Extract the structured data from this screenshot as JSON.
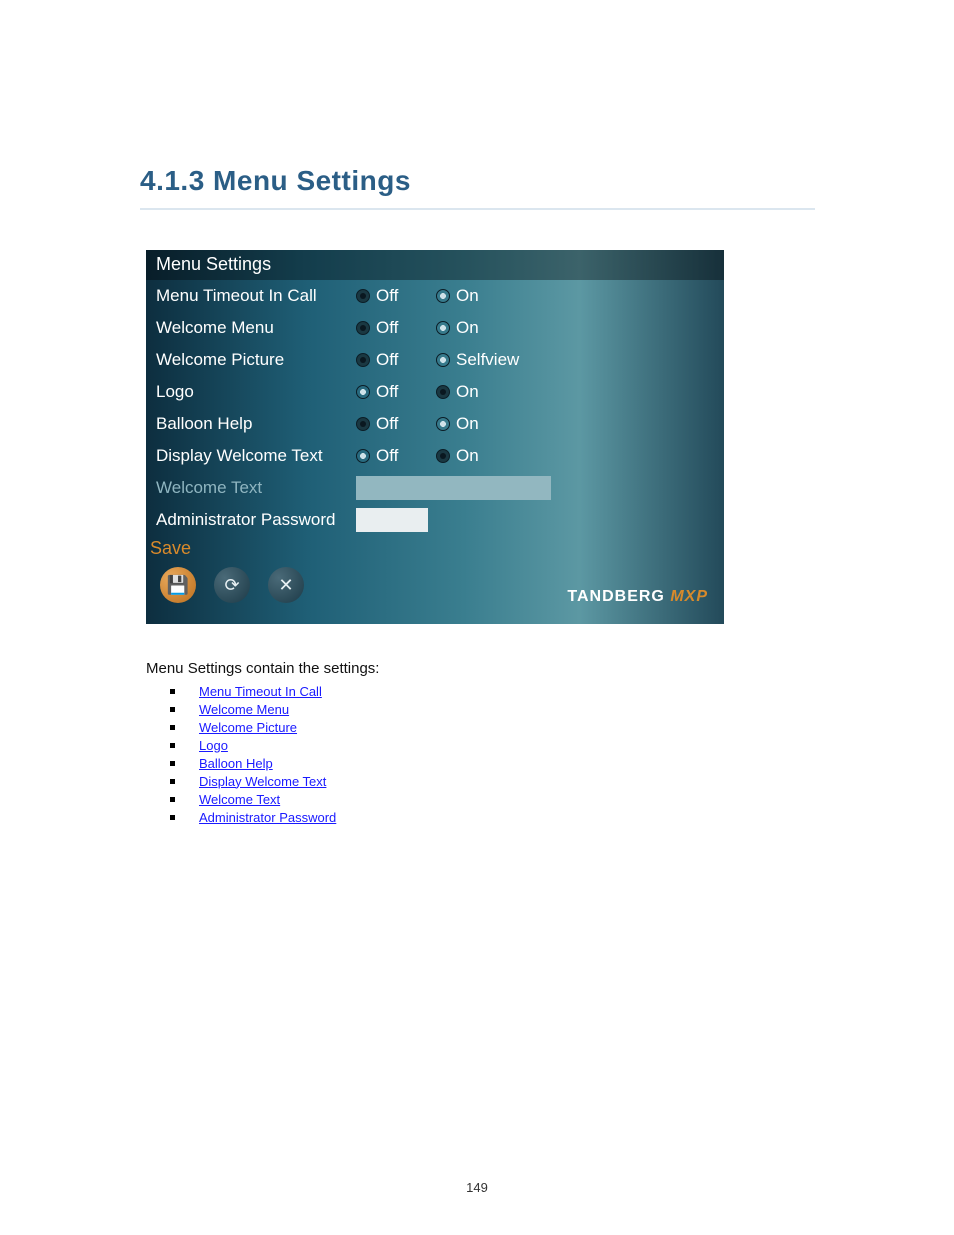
{
  "heading": "4.1.3 Menu Settings",
  "panel": {
    "title": "Menu Settings",
    "rows": [
      {
        "label": "Menu Timeout In Call",
        "off": "Off",
        "on": "On",
        "selected": "off",
        "onLabelWide": false
      },
      {
        "label": "Welcome Menu",
        "off": "Off",
        "on": "On",
        "selected": "off",
        "onLabelWide": false
      },
      {
        "label": "Welcome Picture",
        "off": "Off",
        "on": "Selfview",
        "selected": "off",
        "onLabelWide": true
      },
      {
        "label": "Logo",
        "off": "Off",
        "on": "On",
        "selected": "on",
        "onLabelWide": false
      },
      {
        "label": "Balloon Help",
        "off": "Off",
        "on": "On",
        "selected": "off",
        "onLabelWide": false
      },
      {
        "label": "Display Welcome Text",
        "off": "Off",
        "on": "On",
        "selected": "on",
        "onLabelWide": false
      }
    ],
    "welcomeTextLabel": "Welcome Text",
    "adminPasswordLabel": "Administrator Password",
    "saveLabel": "Save",
    "brand1": "TANDBERG",
    "brand2": " MXP"
  },
  "linksLead": "Menu Settings contain the settings:",
  "links": [
    "Menu Timeout In Call",
    "Welcome Menu",
    "Welcome Picture",
    "Logo",
    "Balloon Help",
    "Display Welcome Text",
    "Welcome Text",
    "Administrator Password"
  ],
  "footerPage": "149"
}
